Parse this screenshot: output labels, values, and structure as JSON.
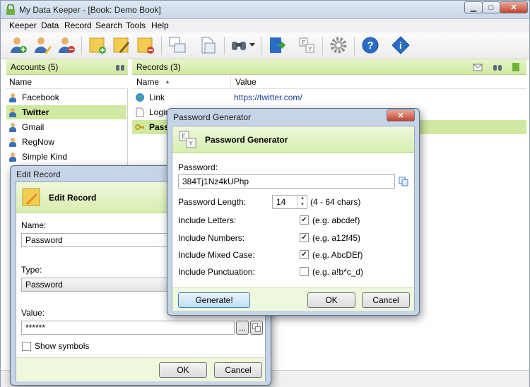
{
  "window": {
    "title": "My Data Keeper - [Book: Demo Book]",
    "min": "▁",
    "max": "□",
    "close": "✕"
  },
  "menu": [
    "Keeper",
    "Data",
    "Record",
    "Search",
    "Tools",
    "Help"
  ],
  "accounts": {
    "header": "Accounts (5)",
    "column": "Name",
    "items": [
      "Facebook",
      "Twitter",
      "Gmail",
      "RegNow",
      "Simple Kind"
    ],
    "selected": 1
  },
  "records": {
    "header": "Records (3)",
    "col_name": "Name",
    "col_value": "Value",
    "rows": [
      {
        "name": "Link",
        "value": "https://twitter.com/"
      },
      {
        "name": "Login",
        "value": ""
      },
      {
        "name": "Pass",
        "value": ""
      }
    ],
    "selected": 2
  },
  "edit_record": {
    "title": "Edit Record",
    "header": "Edit Record",
    "name_label": "Name:",
    "name_value": "Password",
    "type_label": "Type:",
    "type_value": "Password",
    "value_label": "Value:",
    "value_value": "******",
    "browse": "...",
    "show_symbols": "Show symbols",
    "ok": "OK",
    "cancel": "Cancel"
  },
  "pwgen": {
    "title": "Password Generator",
    "header": "Password Generator",
    "password_label": "Password:",
    "password_value": "384Tj1Nz4kUPhp",
    "length_label": "Password Length:",
    "length_value": "14",
    "length_hint": "(4 - 64 chars)",
    "options": [
      {
        "label": "Include Letters:",
        "checked": true,
        "example": "(e.g. abcdef)"
      },
      {
        "label": "Include Numbers:",
        "checked": true,
        "example": "(e.g. a12f45)"
      },
      {
        "label": "Include Mixed Case:",
        "checked": true,
        "example": "(e.g. AbcDEf)"
      },
      {
        "label": "Include Punctuation:",
        "checked": false,
        "example": "(e.g. a!b*c_d)"
      }
    ],
    "generate": "Generate!",
    "ok": "OK",
    "cancel": "Cancel"
  },
  "colors": {
    "accent_green": "#cfe9a0",
    "title_blue": "#c5d4e6",
    "link": "#1a3f9c"
  }
}
